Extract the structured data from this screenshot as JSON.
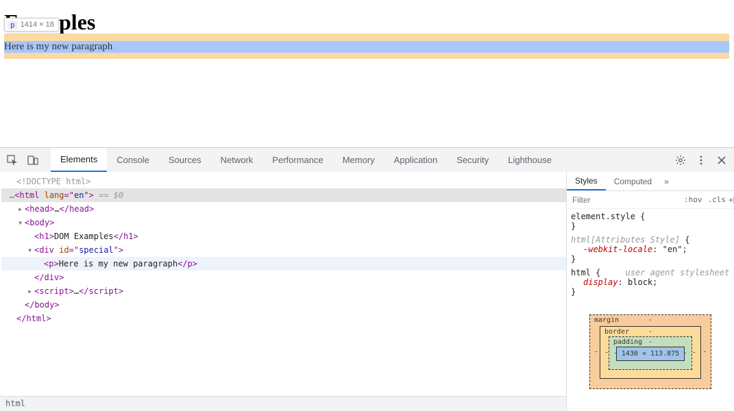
{
  "page": {
    "heading": "Examples",
    "paragraph_text": "Here is my new paragraph"
  },
  "inspect_tooltip": {
    "tag": "p",
    "dimensions": "1414 × 18"
  },
  "devtools": {
    "tabs": [
      "Elements",
      "Console",
      "Sources",
      "Network",
      "Performance",
      "Memory",
      "Application",
      "Security",
      "Lighthouse"
    ],
    "active_tab": "Elements"
  },
  "dom": {
    "doctype": "<!DOCTYPE html>",
    "html_open": "<html lang=\"en\">",
    "html_lang": "en",
    "eq_sel": "== $0",
    "head": "<head>…</head>",
    "body_open": "<body>",
    "h1_open": "<h1>",
    "h1_text": "DOM Examples",
    "h1_close": "</h1>",
    "div_open_tag": "div",
    "div_attr_name": "id",
    "div_attr_val": "special",
    "p_open": "<p>",
    "p_text": "Here is my new paragraph",
    "p_close": "</p>",
    "div_close": "</div>",
    "script_line": "<script>…</scr",
    "script_line2": "ipt>",
    "body_close": "</body>",
    "html_close": "</html>"
  },
  "breadcrumb": "html",
  "styles": {
    "tabs": [
      "Styles",
      "Computed"
    ],
    "filter_placeholder": "Filter",
    "pills": [
      ":hov",
      ".cls"
    ],
    "rule1_sel": "element.style",
    "rule2_sel": "html[Attributes Style]",
    "rule2_prop": "-webkit-locale",
    "rule2_val": "\"en\"",
    "rule3_sel": "html",
    "rule3_src": "user agent stylesheet",
    "rule3_prop": "display",
    "rule3_val": "block"
  },
  "box_model": {
    "margin_label": "margin",
    "border_label": "border",
    "padding_label": "padding",
    "content": "1430 × 113.875",
    "dash": "-"
  }
}
